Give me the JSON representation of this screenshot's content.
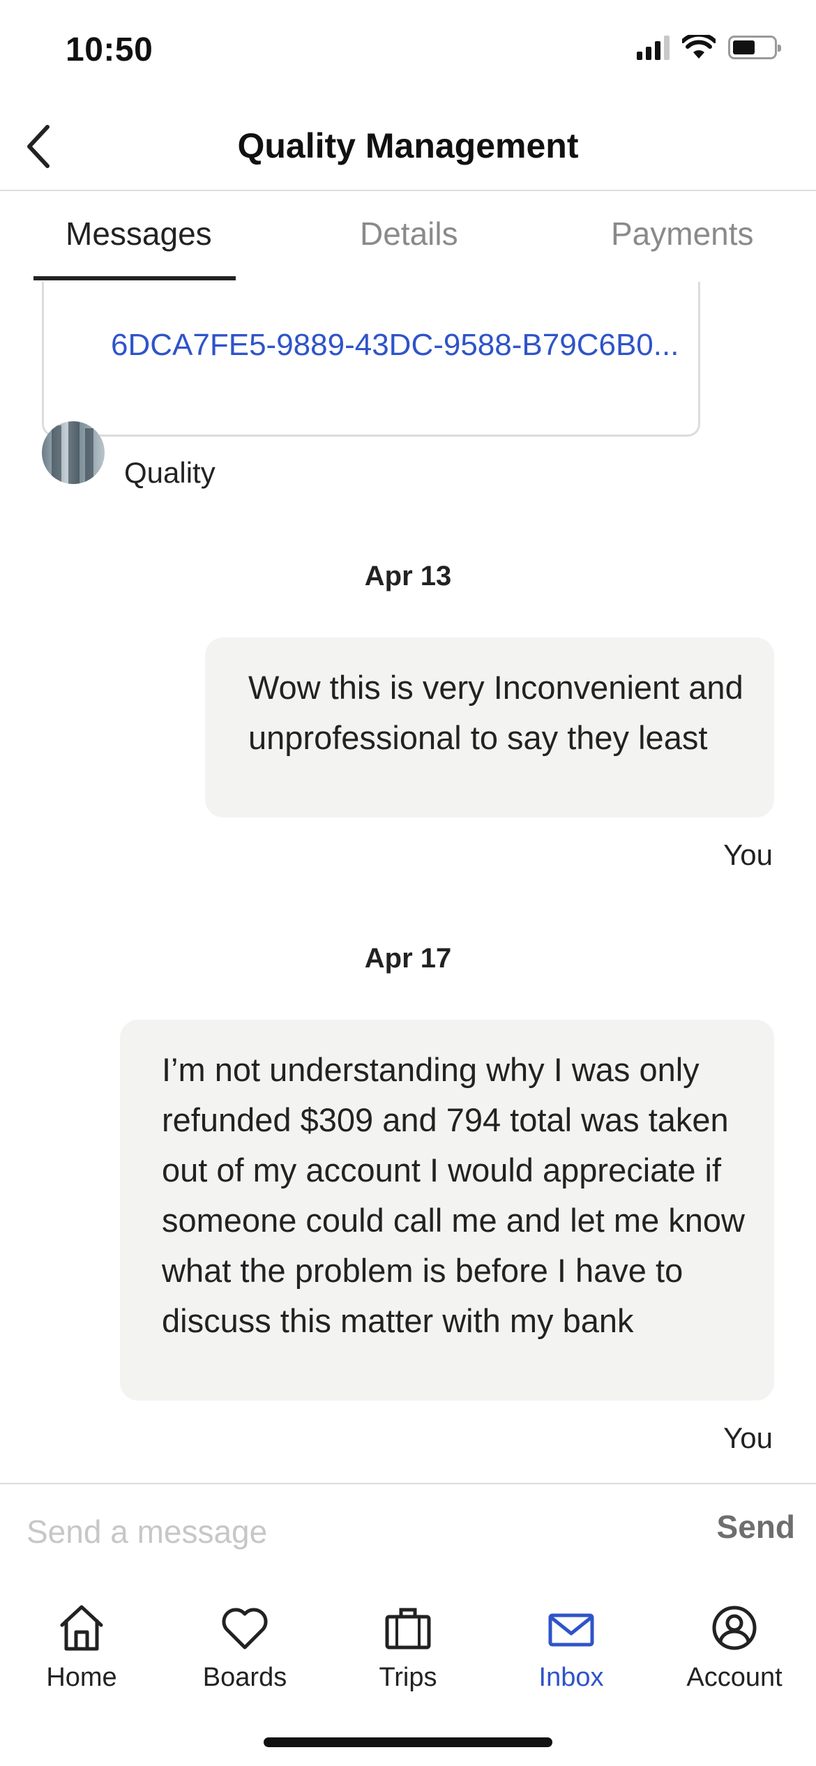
{
  "status_bar": {
    "time": "10:50"
  },
  "header": {
    "title": "Quality Management"
  },
  "tabs": [
    {
      "label": "Messages",
      "active": true
    },
    {
      "label": "Details",
      "active": false
    },
    {
      "label": "Payments",
      "active": false
    }
  ],
  "messages": {
    "card": {
      "link_text": "6DCA7FE5-9889-43DC-9588-B79C6B0..."
    },
    "sender": {
      "name": "Quality"
    },
    "groups": [
      {
        "date": "Apr 13",
        "text": "Wow this is very Inconvenient and unprofessional to say they least",
        "author": "You"
      },
      {
        "date": "Apr 17",
        "text": "I’m not understanding why I was only refunded $309 and 794 total was taken out of my account I would appreciate if someone could call me and let me know what the problem is before I have to discuss this matter with my bank",
        "author": "You"
      }
    ]
  },
  "composer": {
    "placeholder": "Send a message",
    "send_label": "Send"
  },
  "bottom_nav": [
    {
      "label": "Home",
      "icon": "home-icon",
      "active": false
    },
    {
      "label": "Boards",
      "icon": "heart-icon",
      "active": false
    },
    {
      "label": "Trips",
      "icon": "suitcase-icon",
      "active": false
    },
    {
      "label": "Inbox",
      "icon": "envelope-icon",
      "active": true
    },
    {
      "label": "Account",
      "icon": "user-circle-icon",
      "active": false
    }
  ],
  "colors": {
    "accent": "#2f54c9",
    "bubble": "#f3f3f2",
    "divider": "#dcdcdc"
  }
}
